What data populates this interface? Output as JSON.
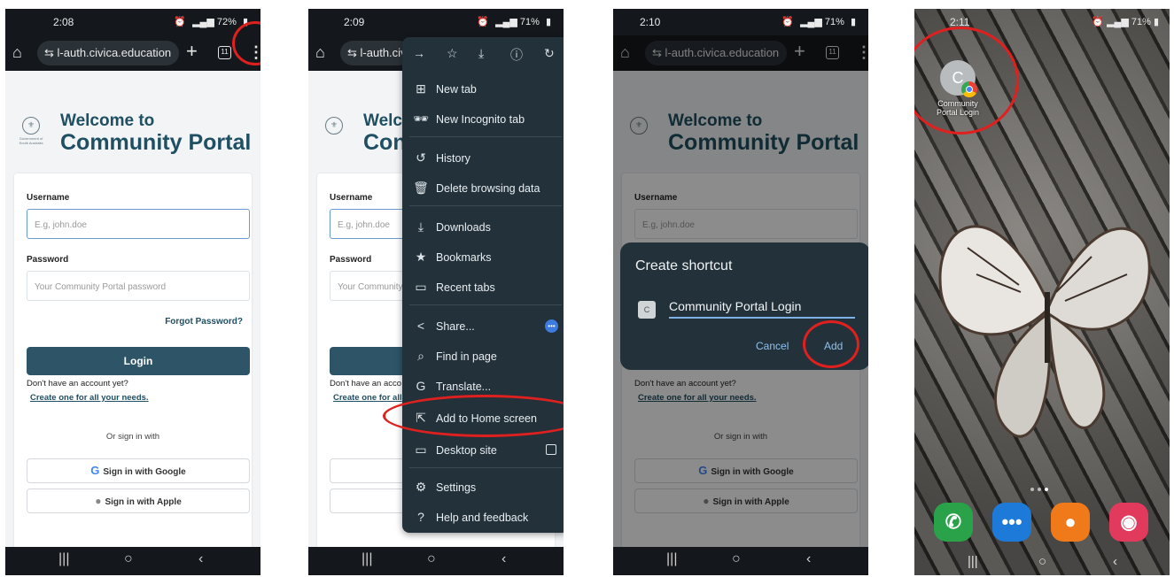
{
  "screen1": {
    "time": "2:08",
    "status_right": "72%",
    "url": "l-auth.civica.education",
    "tab_count": "11",
    "welcome": "Welcome to",
    "portal": "Community Portal",
    "logo_text": "Government of South Australia",
    "username_label": "Username",
    "username_placeholder": "E.g, john.doe",
    "password_label": "Password",
    "password_placeholder": "Your Community Portal password",
    "forgot": "Forgot Password?",
    "login": "Login",
    "no_account": "Don't have an account yet?",
    "create": "Create one for all your needs.",
    "or_sign": "Or sign in with",
    "google": "Sign in with Google",
    "apple": "Sign in with Apple"
  },
  "screen2": {
    "time": "2:09",
    "status_right": "71%",
    "url": "l-auth.civ",
    "welcome": "Welc",
    "portal": "Con",
    "username_label": "Username",
    "username_placeholder": "E.g, john.doe",
    "password_label": "Password",
    "password_placeholder": "Your Community",
    "no_account": "Don't have an acco",
    "create": "Create one for all",
    "menu": {
      "items": [
        {
          "icon": "⊞",
          "label": "New tab"
        },
        {
          "icon": "🕶",
          "label": "New Incognito tab"
        },
        {
          "icon": "↺",
          "label": "History"
        },
        {
          "icon": "🗑",
          "label": "Delete browsing data"
        },
        {
          "icon": "⤓",
          "label": "Downloads"
        },
        {
          "icon": "★",
          "label": "Bookmarks"
        },
        {
          "icon": "▭",
          "label": "Recent tabs"
        },
        {
          "icon": "<",
          "label": "Share..."
        },
        {
          "icon": "⌕",
          "label": "Find in page"
        },
        {
          "icon": "G",
          "label": "Translate..."
        },
        {
          "icon": "⇱",
          "label": "Add to Home screen"
        },
        {
          "icon": "▭",
          "label": "Desktop site"
        },
        {
          "icon": "⚙",
          "label": "Settings"
        },
        {
          "icon": "?",
          "label": "Help and feedback"
        }
      ]
    }
  },
  "screen3": {
    "time": "2:10",
    "status_right": "71%",
    "url": "l-auth.civica.education",
    "tab_count": "11",
    "welcome": "Welcome to",
    "portal": "Community Portal",
    "username_label": "Username",
    "username_placeholder": "E.g, john.doe",
    "no_account": "Don't have an account yet?",
    "create": "Create one for all your needs.",
    "or_sign": "Or sign in with",
    "google": "Sign in with Google",
    "apple": "Sign in with Apple",
    "dialog": {
      "title": "Create shortcut",
      "icon_letter": "C",
      "name_value": "Community Portal Login",
      "cancel": "Cancel",
      "add": "Add"
    }
  },
  "screen4": {
    "time": "2:11",
    "status_right": "71%",
    "shortcut_letter": "C",
    "shortcut_label": "Community Portal Login"
  },
  "colors": {
    "accent": "#2d5567",
    "highlight_ring": "#e0201f",
    "menu_bg": "#22313a"
  }
}
